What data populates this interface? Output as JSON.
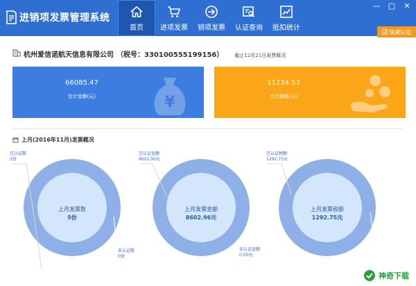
{
  "app": {
    "title": "进销项发票管理系统",
    "window_controls": [
      "—",
      "□",
      "✕"
    ],
    "quick_auth": "快速认证"
  },
  "nav": [
    {
      "label": "首页",
      "icon": "home-icon",
      "active": true
    },
    {
      "label": "进项发票",
      "icon": "cart-icon",
      "active": false
    },
    {
      "label": "销项发票",
      "icon": "arrow-circle-icon",
      "active": false
    },
    {
      "label": "认证查询",
      "icon": "search-doc-icon",
      "active": false
    },
    {
      "label": "抵扣统计",
      "icon": "chart-icon",
      "active": false
    }
  ],
  "company": {
    "name": "杭州爱信诺航天信息有限公司",
    "tax_label": "（税号：330100555199156）",
    "overview_date": "截止12月21日发票概况"
  },
  "cards": {
    "total_amount": {
      "value": "66085.47",
      "label": "合计金额(元)",
      "color": "#3e7de0",
      "icon": "money-bag-icon"
    },
    "total_tax": {
      "value": "11234.53",
      "label": "合计税额(元)",
      "color": "#fba518",
      "icon": "coin-hand-icon"
    }
  },
  "month": {
    "title": "上月(2016年11月)发票概况"
  },
  "charts": [
    {
      "center_label": "上月发票数",
      "center_value": "5份",
      "certified_label": "已认证数",
      "certified_value": "5份",
      "uncertified_label": "未认证数",
      "uncertified_value": "0份",
      "certified_fraction": 1.0
    },
    {
      "center_label": "上月发票金额",
      "center_value": "8602.96元",
      "certified_label": "已认证金额",
      "certified_value": "8602.96元",
      "uncertified_label": "未认证金额",
      "uncertified_value": "0.00元",
      "certified_fraction": 1.0
    },
    {
      "center_label": "上月发票税额",
      "center_value": "1292.75元",
      "certified_label": "已认证税额",
      "certified_value": "1292.75元",
      "uncertified_label": "未认证税额",
      "uncertified_value": "0.00元",
      "certified_fraction": 1.0
    }
  ],
  "colors": {
    "topbar": "#2f6fd1",
    "ring_outer": "#8fb0e6",
    "ring_inner": "#d3e6fb",
    "text_blue": "#2d5aa8"
  },
  "watermark": {
    "text": "神奇下载"
  }
}
